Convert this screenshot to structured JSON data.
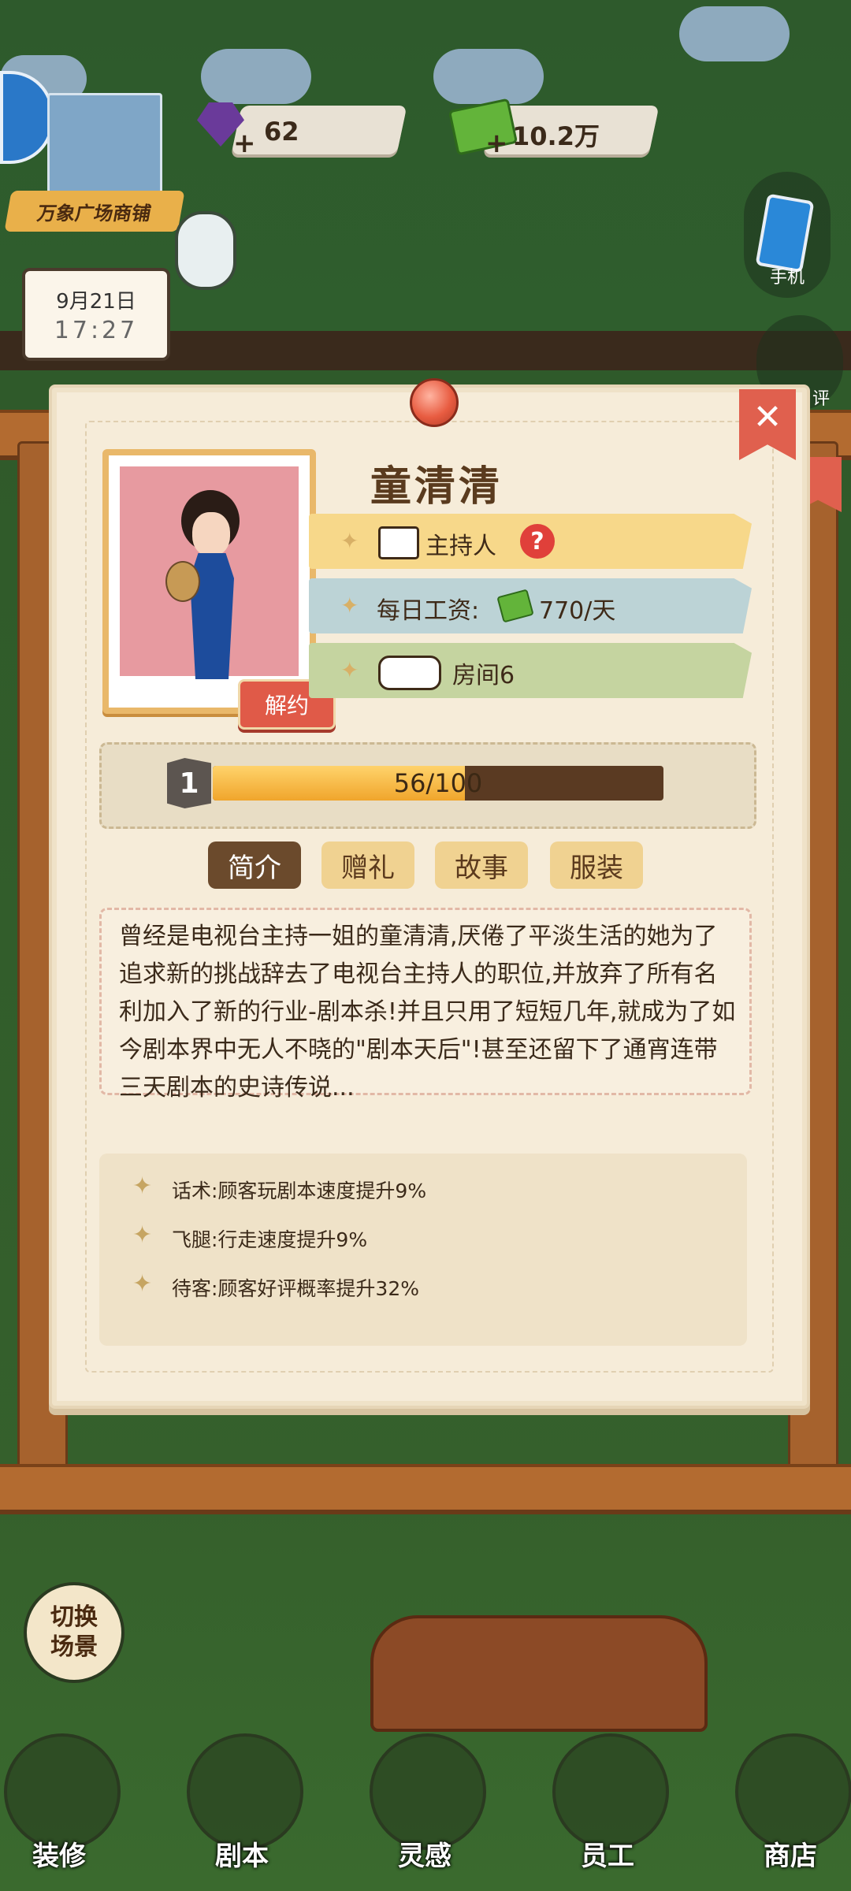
{
  "hud": {
    "gems": "62",
    "cash": "10.2万",
    "location": "万象广场商铺",
    "date": "9月21日",
    "time": "17:27",
    "phone_label": "手机",
    "side_label_2": "评"
  },
  "card": {
    "name": "童清清",
    "role": "主持人",
    "help_mark": "?",
    "wage_label": "每日工资:",
    "wage_value": "770/天",
    "room": "房间6",
    "terminate_label": "解约",
    "level": "1",
    "exp_text": "56/100",
    "exp_fraction": 0.56,
    "tabs": [
      "简介",
      "赠礼",
      "故事",
      "服装"
    ],
    "active_tab": 0,
    "description": "曾经是电视台主持一姐的童清清,厌倦了平淡生活的她为了追求新的挑战辞去了电视台主持人的职位,并放弃了所有名利加入了新的行业-剧本杀!并且只用了短短几年,就成为了如今剧本界中无人不晓的\"剧本天后\"!甚至还留下了通宵连带三天剧本的史诗传说...",
    "skills": [
      "话术:顾客玩剧本速度提升9%",
      "飞腿:行走速度提升9%",
      "待客:顾客好评概率提升32%"
    ]
  },
  "bottom": {
    "switch_scene": "切换场景",
    "nav": [
      "装修",
      "剧本",
      "灵感",
      "员工",
      "商店"
    ]
  },
  "colors": {
    "role_bar": "#f7d88a",
    "wage_bar": "#bcd3d6",
    "room_bar": "#c5d4a0",
    "paper": "#f6ecd9",
    "accent_red": "#e05a48"
  }
}
